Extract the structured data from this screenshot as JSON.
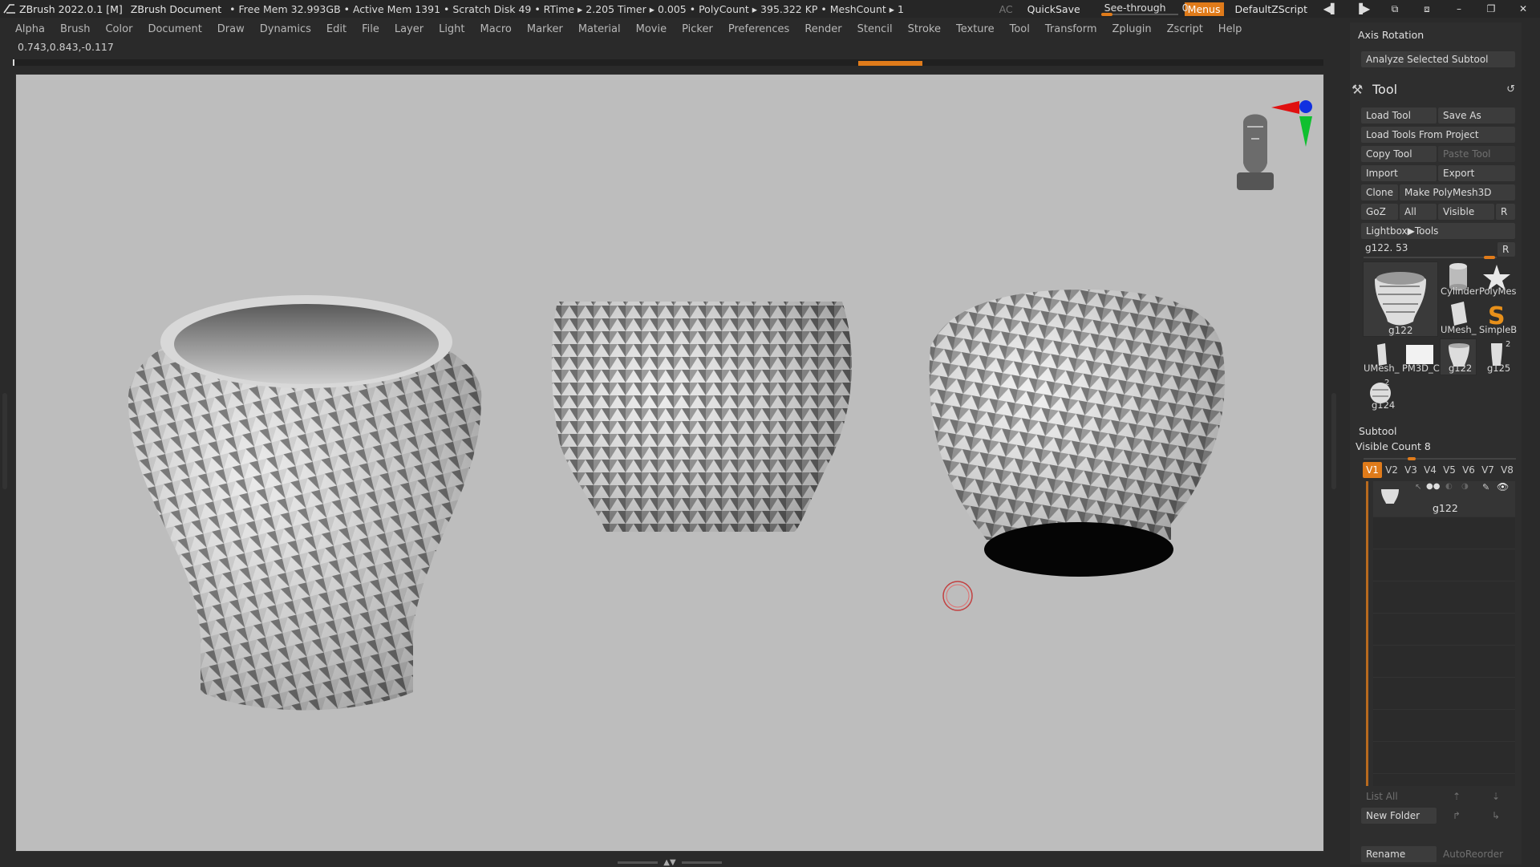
{
  "topbar": {
    "app_title": "ZBrush 2022.0.1 [M]",
    "document": "ZBrush Document",
    "stats": "• Free Mem 32.993GB • Active Mem 1391 • Scratch Disk 49 • RTime ▸ 2.205 Timer ▸ 0.005 • PolyCount ▸ 395.322 KP • MeshCount ▸ 1",
    "ac": "AC",
    "quicksave": "QuickSave",
    "seethrough_label": "See-through",
    "seethrough_value": "0",
    "menus": "Menus",
    "script": "DefaultZScript"
  },
  "menubar": [
    "Alpha",
    "Brush",
    "Color",
    "Document",
    "Draw",
    "Dynamics",
    "Edit",
    "File",
    "Layer",
    "Light",
    "Macro",
    "Marker",
    "Material",
    "Movie",
    "Picker",
    "Preferences",
    "Render",
    "Stencil",
    "Stroke",
    "Texture",
    "Tool",
    "Transform",
    "Zplugin",
    "Zscript",
    "Help"
  ],
  "coords": "0.743,0.843,-0.117",
  "panel": {
    "axis_rotation": "Axis Rotation",
    "analyze": "Analyze Selected Subtool",
    "tool_title": "Tool",
    "buttons": {
      "load_tool": "Load Tool",
      "save_as": "Save As",
      "load_from_project": "Load Tools From Project",
      "copy_tool": "Copy Tool",
      "paste_tool": "Paste Tool",
      "import": "Import",
      "export": "Export",
      "clone": "Clone",
      "make_polymesh": "Make PolyMesh3D",
      "goz": "GoZ",
      "all": "All",
      "visible": "Visible",
      "r": "R",
      "lightbox_tools": "Lightbox▶Tools"
    },
    "current_tool": "g122. 53",
    "current_tool_r": "R",
    "tool_thumbs": {
      "main": "g122",
      "cylinder": "Cylinder",
      "polymesh": "PolyMes",
      "umesh1": "UMesh_",
      "simpleb": "SimpleB",
      "umesh2": "UMesh_",
      "pm3d": "PM3D_C",
      "g122": "g122",
      "g125": "g125",
      "g124": "g124",
      "badge1": "2",
      "badge2": "2"
    },
    "subtool": {
      "title": "Subtool",
      "visible_count": "Visible Count 8",
      "tabs": [
        "V1",
        "V2",
        "V3",
        "V4",
        "V5",
        "V6",
        "V7",
        "V8"
      ],
      "item_name": "g122",
      "list_all": "List All",
      "new_folder": "New Folder",
      "rename": "Rename",
      "autoreorder": "AutoReorder"
    }
  },
  "colors": {
    "accent": "#e07b1a",
    "viewport_bg": "#bdbdbd",
    "panel_bg": "#2e2e2e"
  }
}
